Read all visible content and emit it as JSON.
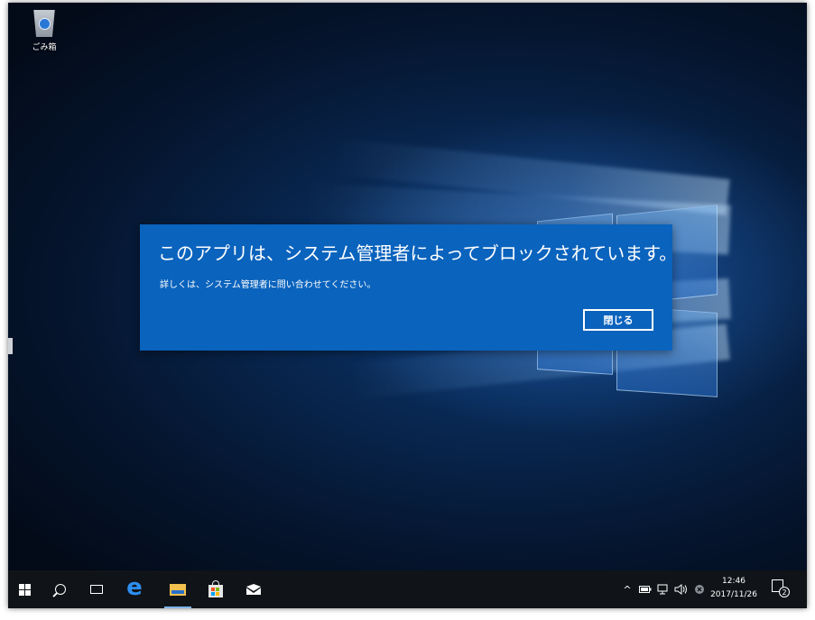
{
  "desktop": {
    "icons": [
      {
        "label": "ごみ箱",
        "icon": "recycle-bin-icon"
      }
    ]
  },
  "dialog": {
    "title": "このアプリは、システム管理者によってブロックされています。",
    "message": "詳しくは、システム管理者に問い合わせてください。",
    "close_label": "閉じる"
  },
  "taskbar": {
    "buttons": [
      {
        "icon": "windows-start-icon"
      },
      {
        "icon": "search-icon"
      },
      {
        "icon": "task-view-icon"
      },
      {
        "icon": "edge-browser-icon"
      },
      {
        "icon": "file-explorer-icon",
        "active": true
      },
      {
        "icon": "store-icon"
      },
      {
        "icon": "mail-icon"
      }
    ],
    "tray": {
      "chevron": "^",
      "clock_time": "12:46",
      "clock_date": "2017/11/26",
      "notification_count": "2"
    }
  },
  "colors": {
    "dialog_bg": "#0a63bd",
    "taskbar_bg": "#101418",
    "accent": "#2d8ef0"
  }
}
